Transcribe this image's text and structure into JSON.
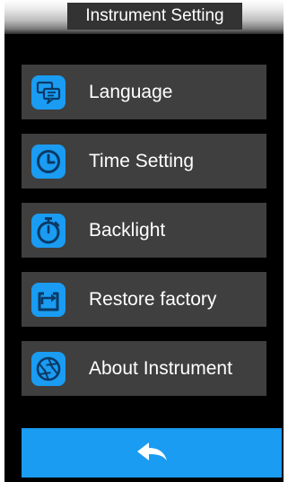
{
  "header": {
    "title": "Instrument Setting"
  },
  "menu": {
    "items": [
      {
        "label": "Language",
        "icon": "language-icon"
      },
      {
        "label": "Time Setting",
        "icon": "clock-icon"
      },
      {
        "label": "Backlight",
        "icon": "stopwatch-icon"
      },
      {
        "label": "Restore factory",
        "icon": "restore-icon"
      },
      {
        "label": "About Instrument",
        "icon": "aperture-icon"
      }
    ]
  },
  "footer": {
    "back_icon": "back-arrow-icon"
  },
  "colors": {
    "accent": "#1a9cf2",
    "item_background": "#3f3f3f",
    "screen_background": "#000000",
    "title_background": "#333333"
  }
}
